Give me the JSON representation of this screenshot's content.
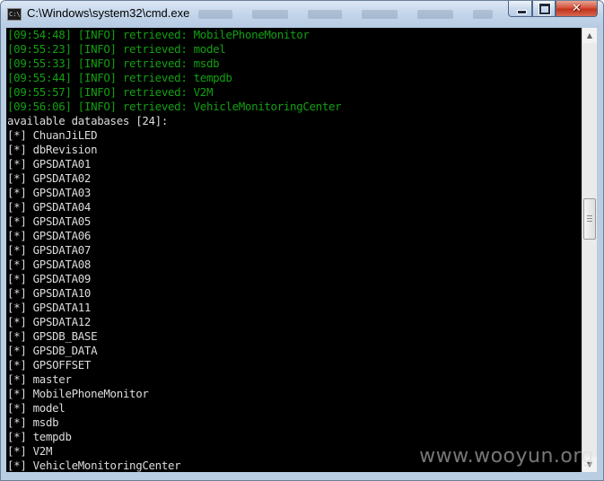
{
  "window": {
    "title": "C:\\Windows\\system32\\cmd.exe",
    "icon": "cmd-icon",
    "icon_glyph": "C:\\",
    "caption_buttons": {
      "minimize_icon": "minimize-icon",
      "maximize_icon": "maximize-icon",
      "close_icon": "close-icon",
      "close_glyph": "✕"
    }
  },
  "console": {
    "lines": [
      {
        "text": "[09:54:48] [INFO] retrieved: MobilePhoneMonitor",
        "kind": "info"
      },
      {
        "text": "[09:55:23] [INFO] retrieved: model",
        "kind": "info"
      },
      {
        "text": "[09:55:33] [INFO] retrieved: msdb",
        "kind": "info"
      },
      {
        "text": "[09:55:44] [INFO] retrieved: tempdb",
        "kind": "info"
      },
      {
        "text": "[09:55:57] [INFO] retrieved: V2M",
        "kind": "info"
      },
      {
        "text": "[09:56:06] [INFO] retrieved: VehicleMonitoringCenter",
        "kind": "info"
      },
      {
        "text": "available databases [24]:",
        "kind": "plain"
      },
      {
        "text": "[*] ChuanJiLED",
        "kind": "plain"
      },
      {
        "text": "[*] dbRevision",
        "kind": "plain"
      },
      {
        "text": "[*] GPSDATA01",
        "kind": "plain"
      },
      {
        "text": "[*] GPSDATA02",
        "kind": "plain"
      },
      {
        "text": "[*] GPSDATA03",
        "kind": "plain"
      },
      {
        "text": "[*] GPSDATA04",
        "kind": "plain"
      },
      {
        "text": "[*] GPSDATA05",
        "kind": "plain"
      },
      {
        "text": "[*] GPSDATA06",
        "kind": "plain"
      },
      {
        "text": "[*] GPSDATA07",
        "kind": "plain"
      },
      {
        "text": "[*] GPSDATA08",
        "kind": "plain"
      },
      {
        "text": "[*] GPSDATA09",
        "kind": "plain"
      },
      {
        "text": "[*] GPSDATA10",
        "kind": "plain"
      },
      {
        "text": "[*] GPSDATA11",
        "kind": "plain"
      },
      {
        "text": "[*] GPSDATA12",
        "kind": "plain"
      },
      {
        "text": "[*] GPSDB_BASE",
        "kind": "plain"
      },
      {
        "text": "[*] GPSDB_DATA",
        "kind": "plain"
      },
      {
        "text": "[*] GPSOFFSET",
        "kind": "plain"
      },
      {
        "text": "[*] master",
        "kind": "plain"
      },
      {
        "text": "[*] MobilePhoneMonitor",
        "kind": "plain"
      },
      {
        "text": "[*] model",
        "kind": "plain"
      },
      {
        "text": "[*] msdb",
        "kind": "plain"
      },
      {
        "text": "[*] tempdb",
        "kind": "plain"
      },
      {
        "text": "[*] V2M",
        "kind": "plain"
      },
      {
        "text": "[*] VehicleMonitoringCenter",
        "kind": "plain"
      }
    ]
  },
  "scrollbar": {
    "up_icon": "scroll-up-arrow-icon",
    "down_icon": "scroll-down-arrow-icon",
    "up_glyph": "▲",
    "down_glyph": "▼"
  },
  "watermark": {
    "text": "www.wooyun.org"
  },
  "colors": {
    "console_background": "#000000",
    "info_text": "#12a012",
    "plain_text": "#dcdcdc",
    "close_button": "#c2331c"
  }
}
